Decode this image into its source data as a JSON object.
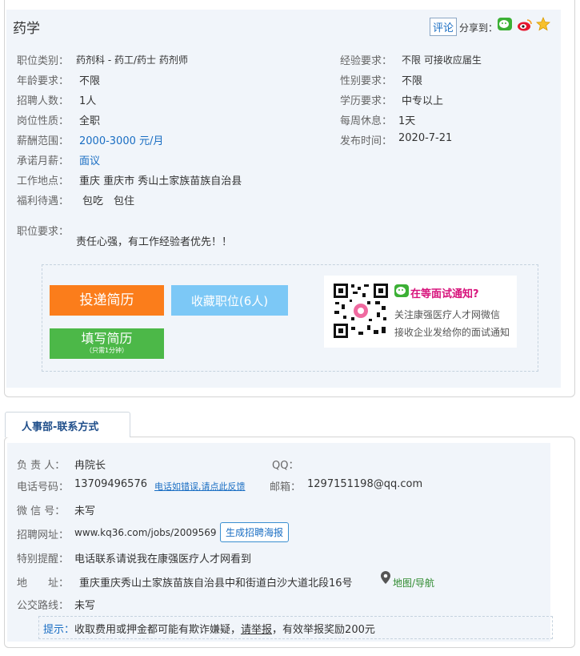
{
  "job": {
    "title": "药学",
    "comment_label": "评论",
    "share_label": "分享到：",
    "left_fields": [
      {
        "label": "职位类别：",
        "value": "药剂科 - 药工/药士 药剂师"
      },
      {
        "label": "年龄要求：",
        "value": "不限"
      },
      {
        "label": "招聘人数：",
        "value": "1人"
      },
      {
        "label": "岗位性质：",
        "value": "全职"
      },
      {
        "label": "薪酬范围：",
        "value": "2000-3000 元/月"
      },
      {
        "label": "承诺月薪：",
        "value": "面议"
      },
      {
        "label": "工作地点：",
        "value": "重庆 重庆市 秀山土家族苗族自治县"
      },
      {
        "label": "福利待遇：",
        "value": "包吃　包住"
      }
    ],
    "right_fields": [
      {
        "label": "经验要求：",
        "value": "不限 可接收应届生"
      },
      {
        "label": "性别要求：",
        "value": "不限"
      },
      {
        "label": "学历要求：",
        "value": "中专以上"
      },
      {
        "label": "每周休息：",
        "value": "1天"
      },
      {
        "label": "发布时间：",
        "value": "2020-7-21"
      }
    ],
    "req_label": "职位要求：",
    "req_text": "责任心强，有工作经验者优先！！",
    "apply_label": "投递简历",
    "fav_label": "收藏职位(6人)",
    "fill_label": "填写简历",
    "fill_sub": "（只需1分钟）",
    "wechat_title": "在等面试通知?",
    "wechat_line1": "关注康强医疗人才网微信",
    "wechat_line2": "接收企业发给你的面试通知"
  },
  "contact": {
    "tab_label": "人事部-联系方式",
    "person_label": "负 责 人：",
    "person": "冉院长",
    "qq_label": "QQ：",
    "phone_label": "电话号码：",
    "phone": "13709496576",
    "phone_link": "电话如错误,请点此反馈",
    "email_label": "邮箱：",
    "email": "1297151198@qq.com",
    "wechat_label": "微 信 号：",
    "wechat": "未写",
    "url_label": "招聘网址：",
    "url": "www.kq36.com/jobs/2009569",
    "poster_btn": "生成招聘海报",
    "remind_label": "特别提醒：",
    "remind": "电话联系请说我在康强医疗人才网看到",
    "addr_label": "地　　址：",
    "addr": "重庆重庆秀山土家族苗族自治县中和街道白沙大道北段16号",
    "map_link": "地图/导航",
    "bus_label": "公交路线：",
    "bus": "未写",
    "tip_label": "提示：",
    "tip_a": "收取费用或押金都可能有欺诈嫌疑，",
    "tip_link": "请举报",
    "tip_b": "，有效举报奖励200元"
  },
  "colors": {
    "orange": "#fb7d1b",
    "lightblue": "#7cc8f6",
    "green": "#4cb848",
    "panel": "#f1f5fa",
    "link": "#1a6ec3"
  }
}
